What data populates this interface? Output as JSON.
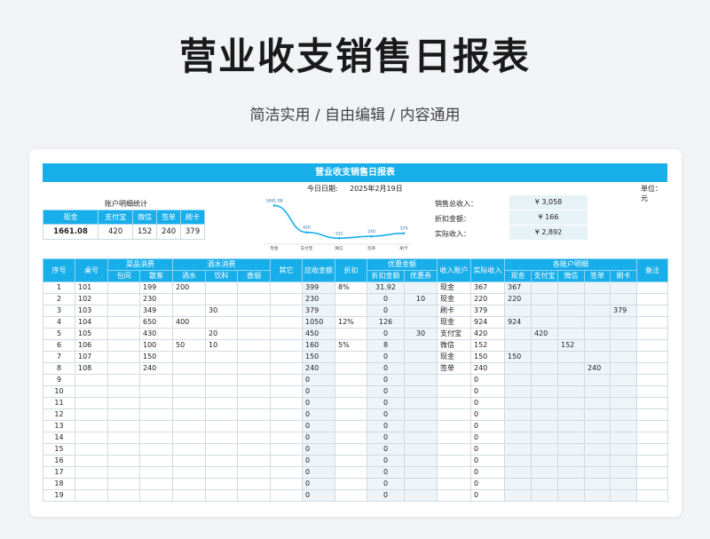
{
  "hero": {
    "title": "营业收支销售日报表",
    "subtitle": "简洁实用 / 自由编辑 / 内容通用"
  },
  "sheet": {
    "title": "营业收支销售日报表",
    "date_label": "今日日期:",
    "date_value": "2025年2月19日",
    "unit": "单位：元"
  },
  "account_summary": {
    "title": "账户明细统计",
    "headers": [
      "现金",
      "支付宝",
      "微信",
      "签单",
      "刷卡"
    ],
    "values": [
      "1661.08",
      "420",
      "152",
      "240",
      "379"
    ]
  },
  "chart_data": {
    "type": "line",
    "categories": [
      "现金",
      "支付宝",
      "微信",
      "签单",
      "刷卡"
    ],
    "values": [
      1661.08,
      420,
      152,
      240,
      379
    ],
    "data_labels": [
      "1661.08",
      "420",
      "152",
      "240",
      "379"
    ],
    "ylim": [
      0,
      1800
    ],
    "grid": false,
    "color": "#17aeea"
  },
  "totals": [
    {
      "label": "销售总收入：",
      "value": "¥ 3,058"
    },
    {
      "label": "折扣金额：",
      "value": "¥ 166"
    },
    {
      "label": "实际收入：",
      "value": "¥ 2,892"
    }
  ],
  "table": {
    "groups": {
      "dishes": "菜品消费",
      "drinks": "酒水消费",
      "discount": "优惠金额",
      "accounts": "各账户明细"
    },
    "single_headers": {
      "seq": "序号",
      "table_no": "桌号",
      "other": "其它",
      "receivable": "应收金额",
      "rate": "折扣",
      "account": "收入账户",
      "actual": "实际收入",
      "note": "备注"
    },
    "sub_headers": {
      "dishes": [
        "包间",
        "散客"
      ],
      "drinks": [
        "酒水",
        "饮料",
        "香烟"
      ],
      "discount": [
        "折扣金额",
        "优惠券"
      ],
      "accounts": [
        "现金",
        "支付宝",
        "微信",
        "签单",
        "刷卡"
      ]
    },
    "rows": [
      [
        "1",
        "101",
        "",
        "199",
        "200",
        "",
        "",
        "",
        "399",
        "8%",
        "31.92",
        "",
        "现金",
        "367",
        "367",
        "",
        "",
        "",
        "",
        ""
      ],
      [
        "2",
        "102",
        "",
        "230",
        "",
        "",
        "",
        "",
        "230",
        "",
        "0",
        "10",
        "现金",
        "220",
        "220",
        "",
        "",
        "",
        "",
        ""
      ],
      [
        "3",
        "103",
        "",
        "349",
        "",
        "30",
        "",
        "",
        "379",
        "",
        "0",
        "",
        "刷卡",
        "379",
        "",
        "",
        "",
        "",
        "379",
        ""
      ],
      [
        "4",
        "104",
        "",
        "650",
        "400",
        "",
        "",
        "",
        "1050",
        "12%",
        "126",
        "",
        "现金",
        "924",
        "924",
        "",
        "",
        "",
        "",
        ""
      ],
      [
        "5",
        "105",
        "",
        "430",
        "",
        "20",
        "",
        "",
        "450",
        "",
        "0",
        "30",
        "支付宝",
        "420",
        "",
        "420",
        "",
        "",
        "",
        ""
      ],
      [
        "6",
        "106",
        "",
        "100",
        "50",
        "10",
        "",
        "",
        "160",
        "5%",
        "8",
        "",
        "微信",
        "152",
        "",
        "",
        "152",
        "",
        "",
        ""
      ],
      [
        "7",
        "107",
        "",
        "150",
        "",
        "",
        "",
        "",
        "150",
        "",
        "0",
        "",
        "现金",
        "150",
        "150",
        "",
        "",
        "",
        "",
        ""
      ],
      [
        "8",
        "108",
        "",
        "240",
        "",
        "",
        "",
        "",
        "240",
        "",
        "0",
        "",
        "签单",
        "240",
        "",
        "",
        "",
        "240",
        "",
        ""
      ],
      [
        "9",
        "",
        "",
        "",
        "",
        "",
        "",
        "",
        "0",
        "",
        "0",
        "",
        "",
        "0",
        "",
        "",
        "",
        "",
        "",
        ""
      ],
      [
        "10",
        "",
        "",
        "",
        "",
        "",
        "",
        "",
        "0",
        "",
        "0",
        "",
        "",
        "0",
        "",
        "",
        "",
        "",
        "",
        ""
      ],
      [
        "11",
        "",
        "",
        "",
        "",
        "",
        "",
        "",
        "0",
        "",
        "0",
        "",
        "",
        "0",
        "",
        "",
        "",
        "",
        "",
        ""
      ],
      [
        "12",
        "",
        "",
        "",
        "",
        "",
        "",
        "",
        "0",
        "",
        "0",
        "",
        "",
        "0",
        "",
        "",
        "",
        "",
        "",
        ""
      ],
      [
        "13",
        "",
        "",
        "",
        "",
        "",
        "",
        "",
        "0",
        "",
        "0",
        "",
        "",
        "0",
        "",
        "",
        "",
        "",
        "",
        ""
      ],
      [
        "14",
        "",
        "",
        "",
        "",
        "",
        "",
        "",
        "0",
        "",
        "0",
        "",
        "",
        "0",
        "",
        "",
        "",
        "",
        "",
        ""
      ],
      [
        "15",
        "",
        "",
        "",
        "",
        "",
        "",
        "",
        "0",
        "",
        "0",
        "",
        "",
        "0",
        "",
        "",
        "",
        "",
        "",
        ""
      ],
      [
        "16",
        "",
        "",
        "",
        "",
        "",
        "",
        "",
        "0",
        "",
        "0",
        "",
        "",
        "0",
        "",
        "",
        "",
        "",
        "",
        ""
      ],
      [
        "17",
        "",
        "",
        "",
        "",
        "",
        "",
        "",
        "0",
        "",
        "0",
        "",
        "",
        "0",
        "",
        "",
        "",
        "",
        "",
        ""
      ],
      [
        "18",
        "",
        "",
        "",
        "",
        "",
        "",
        "",
        "0",
        "",
        "0",
        "",
        "",
        "0",
        "",
        "",
        "",
        "",
        "",
        ""
      ],
      [
        "19",
        "",
        "",
        "",
        "",
        "",
        "",
        "",
        "0",
        "",
        "0",
        "",
        "",
        "0",
        "",
        "",
        "",
        "",
        "",
        ""
      ]
    ]
  }
}
